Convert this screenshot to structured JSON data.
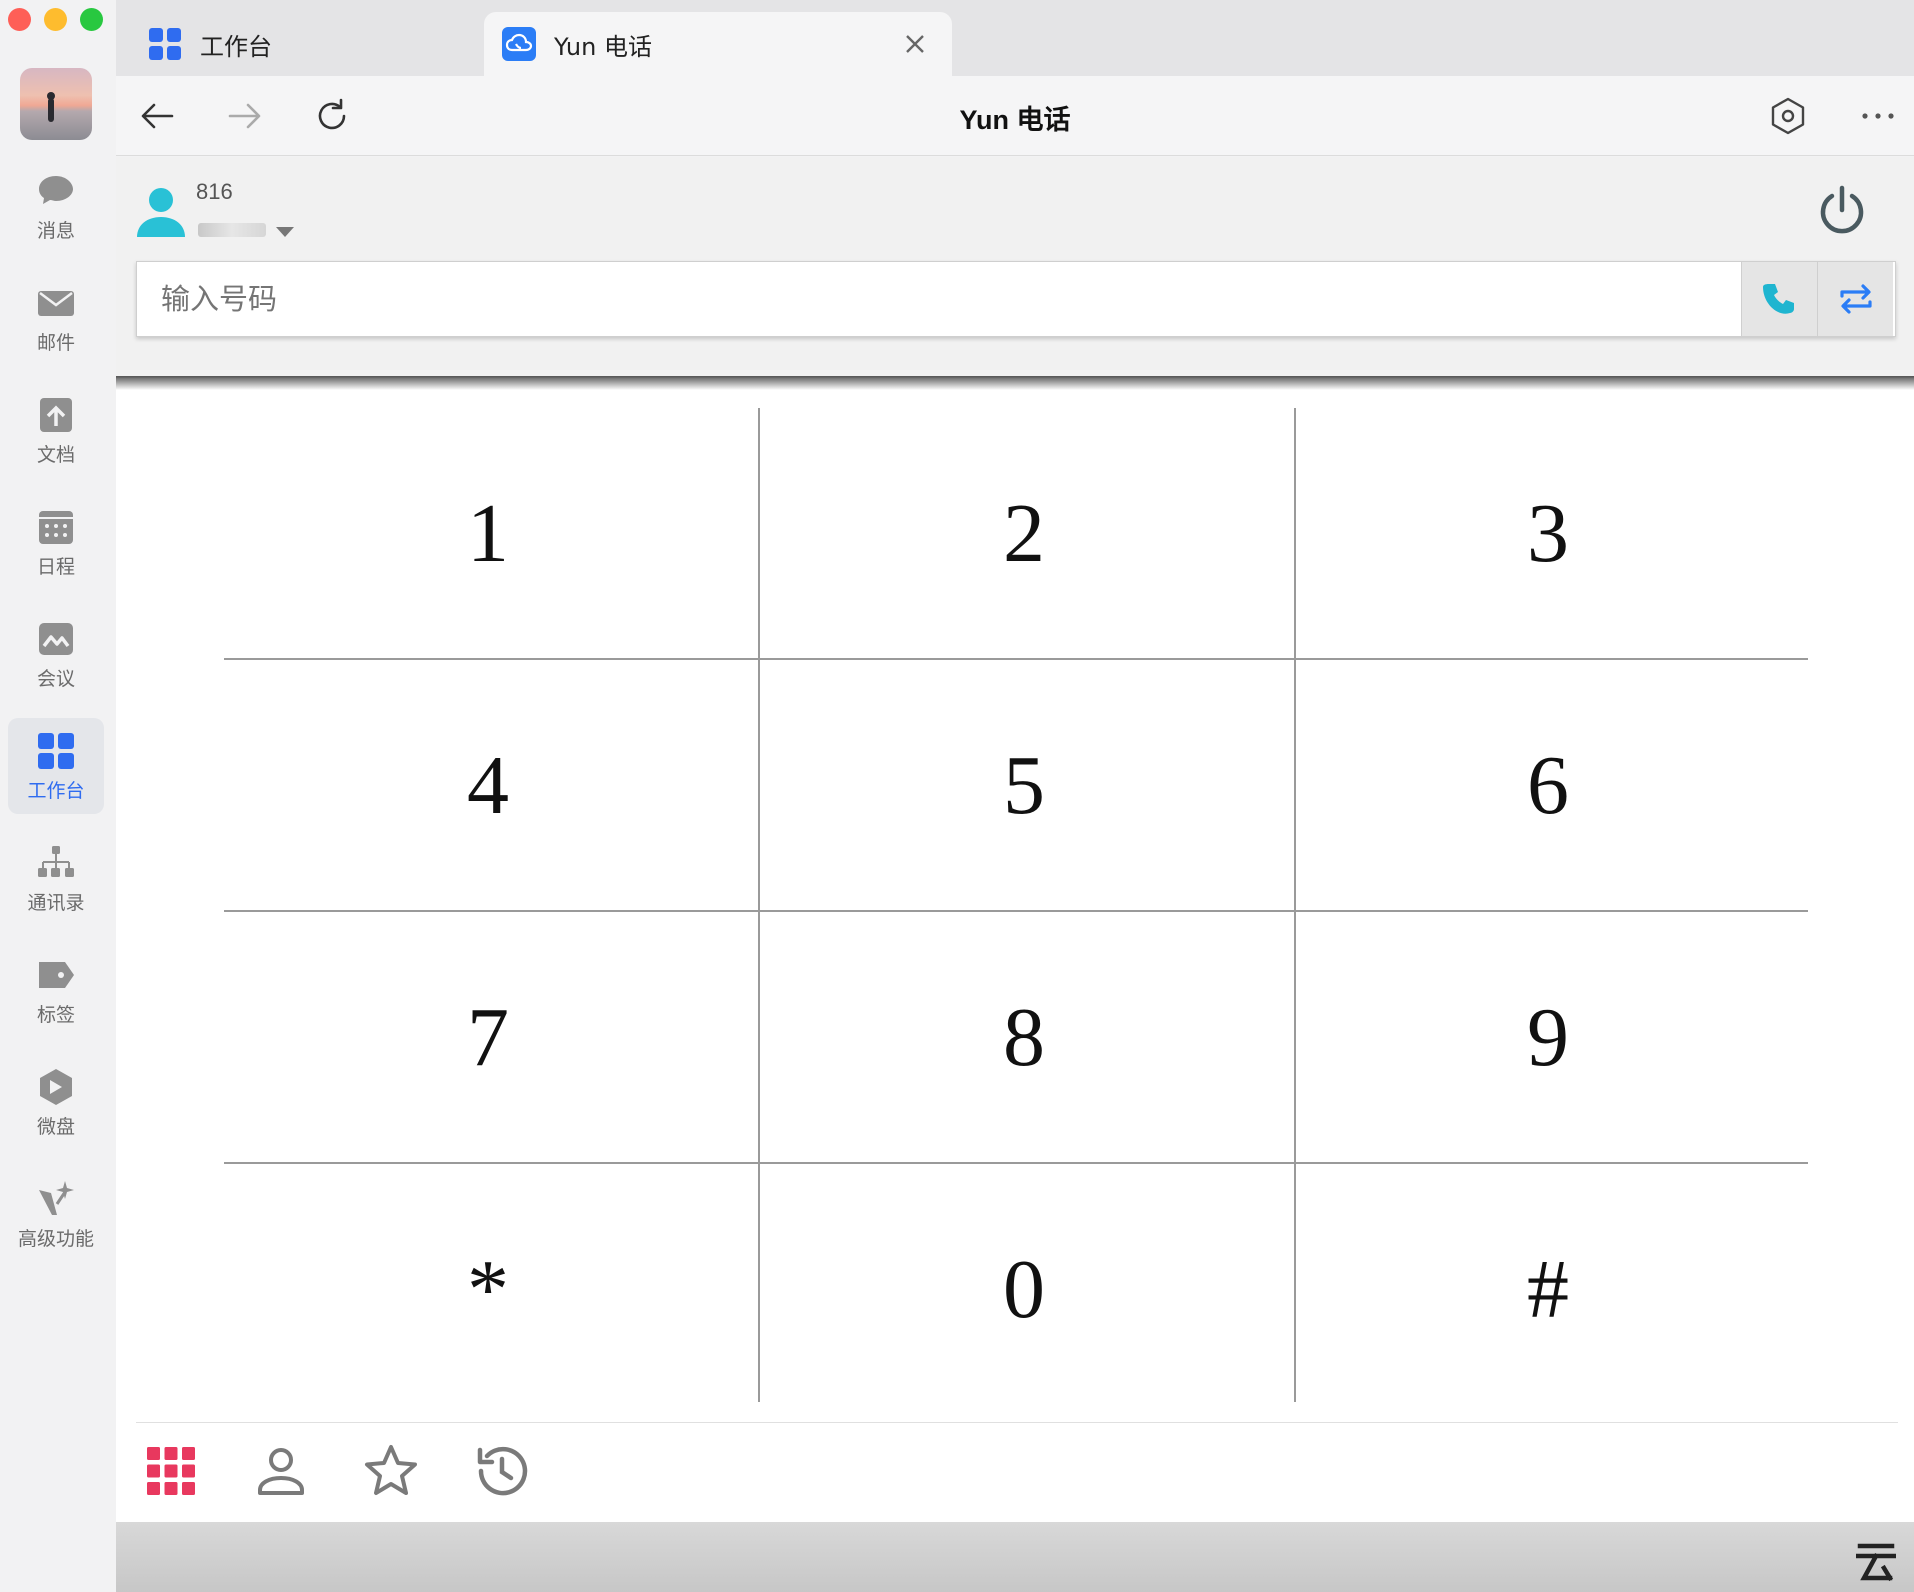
{
  "sidebar": {
    "items": [
      {
        "label": "消息",
        "icon": "chat-bubble-icon"
      },
      {
        "label": "邮件",
        "icon": "mail-icon"
      },
      {
        "label": "文档",
        "icon": "document-icon"
      },
      {
        "label": "日程",
        "icon": "calendar-icon"
      },
      {
        "label": "会议",
        "icon": "meeting-icon"
      },
      {
        "label": "工作台",
        "icon": "workspace-grid-icon",
        "active": true
      },
      {
        "label": "通讯录",
        "icon": "org-chart-icon"
      },
      {
        "label": "标签",
        "icon": "tag-icon"
      },
      {
        "label": "微盘",
        "icon": "drive-icon"
      },
      {
        "label": "高级功能",
        "icon": "sparkle-icon"
      }
    ]
  },
  "tabs": [
    {
      "label": "工作台",
      "icon": "workspace-grid-icon",
      "active": false
    },
    {
      "label": "Yun 电话",
      "icon": "cloud-phone-icon",
      "active": true
    }
  ],
  "toolbar": {
    "title": "Yun 电话"
  },
  "phone": {
    "extension": "816",
    "input_placeholder": "输入号码",
    "input_value": ""
  },
  "dialpad": {
    "keys": [
      "1",
      "2",
      "3",
      "4",
      "5",
      "6",
      "7",
      "8",
      "9",
      "*",
      "0",
      "#"
    ]
  },
  "bottom_nav": {
    "items": [
      "dialpad-icon",
      "contacts-icon",
      "favorites-icon",
      "history-icon"
    ],
    "active": "dialpad-icon"
  },
  "colors": {
    "accent_blue": "#2f6cf0",
    "phone_teal": "#1fb5d0",
    "dialpad_active_pink": "#e8385e",
    "sidebar_bg": "#f2f2f3"
  }
}
